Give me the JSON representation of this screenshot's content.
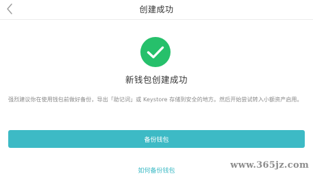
{
  "nav": {
    "title": "创建成功"
  },
  "icons": {
    "back": "chevron-left-icon",
    "success": "check-circle-icon"
  },
  "colors": {
    "accent": "#3dbac5",
    "success": "#26c06b"
  },
  "main": {
    "success_title": "新钱包创建成功",
    "description": "强烈建议你在使用钱包前做好备份，导出「助记词」或 Keystore 存储到安全的地方。然后开始尝试转入小额资产启用。",
    "backup_button": "备份钱包",
    "help_link": "如何备份钱包"
  },
  "watermark": {
    "text": "www.365jz.com"
  }
}
